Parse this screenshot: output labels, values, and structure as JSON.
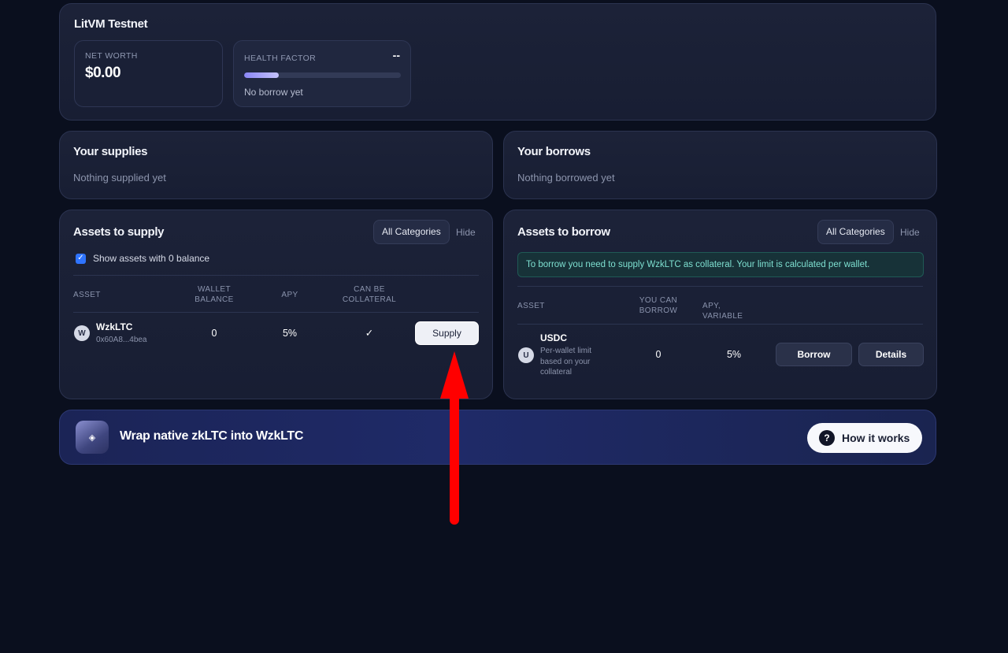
{
  "network": {
    "title": "LitVM Testnet"
  },
  "stats": {
    "net_worth_label": "NET WORTH",
    "net_worth_value": "$0.00",
    "health_factor_label": "HEALTH FACTOR",
    "health_factor_value": "--",
    "health_factor_progress": 0.22,
    "health_factor_note": "No borrow yet"
  },
  "supplies": {
    "title": "Your supplies",
    "empty": "Nothing supplied yet"
  },
  "borrows": {
    "title": "Your borrows",
    "empty": "Nothing borrowed yet"
  },
  "supply_assets": {
    "title": "Assets to supply",
    "category_button": "All Categories",
    "hide_label": "Hide",
    "show_zero_label": "Show assets with 0 balance",
    "show_zero_checked": true,
    "columns": {
      "asset": "ASSET",
      "wallet_balance": "WALLET BALANCE",
      "apy": "APY",
      "collateral": "CAN BE COLLATERAL"
    },
    "rows": [
      {
        "icon_letter": "W",
        "name": "WzkLTC",
        "address": "0x60A8...4bea",
        "wallet_balance": "0",
        "apy": "5%",
        "collateral": "✓",
        "action": "Supply"
      }
    ]
  },
  "borrow_assets": {
    "title": "Assets to borrow",
    "category_button": "All Categories",
    "hide_label": "Hide",
    "info": "To borrow you need to supply WzkLTC as collateral. Your limit is calculated per wallet.",
    "columns": {
      "asset": "ASSET",
      "you_can_borrow": "YOU CAN BORROW",
      "apy_variable": "APY, VARIABLE"
    },
    "rows": [
      {
        "icon_letter": "U",
        "name": "USDC",
        "note": "Per-wallet limit based on your collateral",
        "you_can_borrow": "0",
        "apy": "5%",
        "borrow_label": "Borrow",
        "details_label": "Details"
      }
    ]
  },
  "wrap": {
    "icon": "◈",
    "title": "Wrap native zkLTC into WzkLTC",
    "how_icon": "?",
    "how_label": "How it works"
  },
  "colors": {
    "background": "#0a0f1e",
    "accent": "#8a86f5",
    "annotation_arrow": "#ff0000",
    "info_text": "#7ee0d1"
  }
}
